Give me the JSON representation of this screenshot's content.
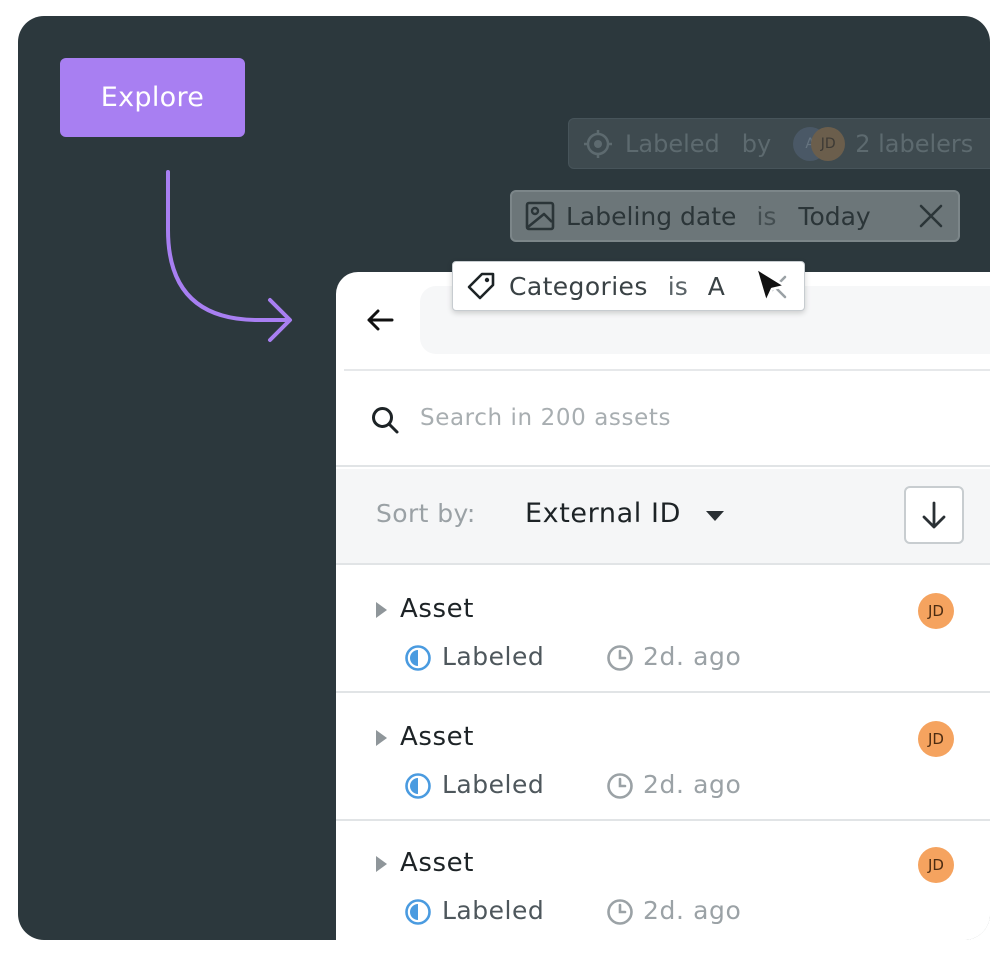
{
  "explore_button": {
    "label": "Explore"
  },
  "filters": {
    "labeled": {
      "field": "Labeled",
      "operator": "by",
      "avatars": [
        "A",
        "JD"
      ],
      "value": "2 labelers"
    },
    "labeling_date": {
      "field": "Labeling date",
      "operator": "is",
      "value": "Today"
    },
    "categories": {
      "field": "Categories",
      "operator": "is",
      "value": "A"
    }
  },
  "search": {
    "placeholder": "Search in 200 assets"
  },
  "sort": {
    "label": "Sort by:",
    "value": "External ID"
  },
  "assets": [
    {
      "title": "Asset",
      "status": "Labeled",
      "time": "2d. ago",
      "avatar": "JD"
    },
    {
      "title": "Asset",
      "status": "Labeled",
      "time": "2d. ago",
      "avatar": "JD"
    },
    {
      "title": "Asset",
      "status": "Labeled",
      "time": "2d. ago",
      "avatar": "JD"
    }
  ],
  "colors": {
    "accent": "#a87ff2",
    "background": "#2c383d",
    "avatar": "#f5a35f",
    "status": "#4a9be0"
  }
}
